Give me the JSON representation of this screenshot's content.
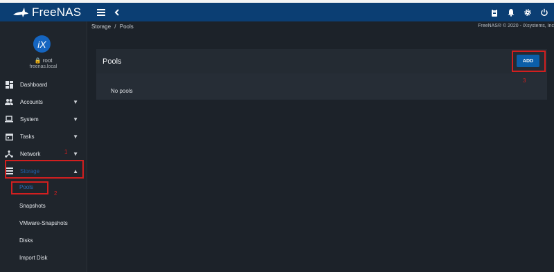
{
  "app": {
    "name": "FreeNAS"
  },
  "topbar": {
    "icons": [
      "menu-icon",
      "chevron-left-icon",
      "clipboard-icon",
      "bell-icon",
      "gear-icon",
      "power-icon"
    ]
  },
  "profile": {
    "user": "root",
    "host": "freenas.local",
    "logo_text": "iX"
  },
  "sidebar": {
    "items": [
      {
        "label": "Dashboard",
        "icon": "dashboard-icon"
      },
      {
        "label": "Accounts",
        "icon": "people-icon"
      },
      {
        "label": "System",
        "icon": "laptop-icon"
      },
      {
        "label": "Tasks",
        "icon": "calendar-icon"
      },
      {
        "label": "Network",
        "icon": "network-icon"
      },
      {
        "label": "Storage",
        "icon": "storage-icon"
      }
    ],
    "subitems": [
      {
        "label": "Pools"
      },
      {
        "label": "Snapshots"
      },
      {
        "label": "VMware-Snapshots"
      },
      {
        "label": "Disks"
      },
      {
        "label": "Import Disk"
      }
    ]
  },
  "breadcrumb": {
    "root": "Storage",
    "sep": "/",
    "current": "Pools"
  },
  "copyright": "FreeNAS® © 2020 - iXsystems, Inc",
  "pools": {
    "title": "Pools",
    "add_label": "ADD",
    "empty_text": "No pools"
  },
  "annotations": {
    "network": "1",
    "pools": "2",
    "add": "3"
  },
  "colors": {
    "topbar": "#0b3e73",
    "accent": "#0b5ea8",
    "highlight": "#d21f1f"
  }
}
